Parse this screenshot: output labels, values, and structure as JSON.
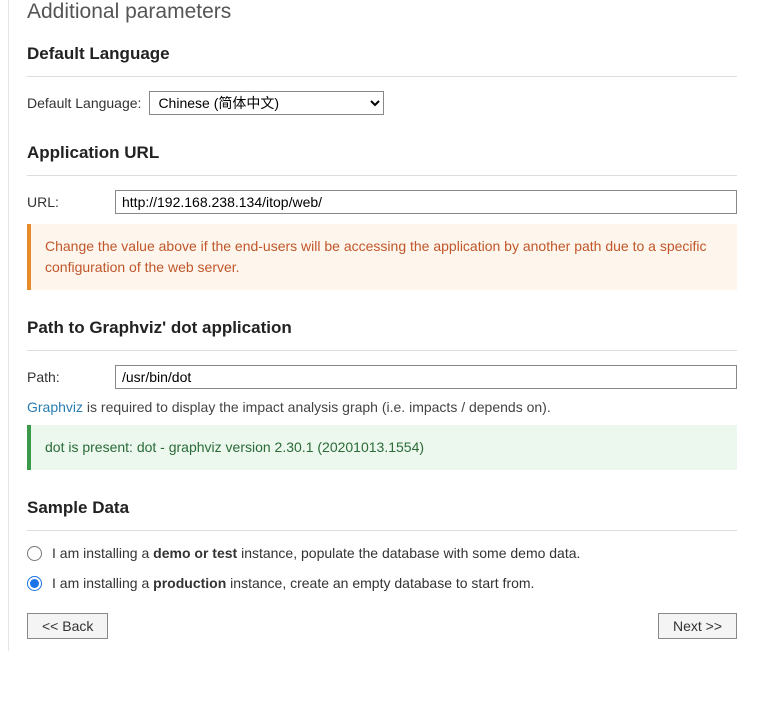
{
  "page_title": "Additional parameters",
  "sections": {
    "default_language": {
      "heading": "Default Language",
      "label": "Default Language:",
      "selected": "Chinese (简体中文)"
    },
    "app_url": {
      "heading": "Application URL",
      "label": "URL:",
      "value": "http://192.168.238.134/itop/web/",
      "warning": "Change the value above if the end-users will be accessing the application by another path due to a specific configuration of the web server."
    },
    "graphviz": {
      "heading": "Path to Graphviz' dot application",
      "label": "Path:",
      "value": "/usr/bin/dot",
      "link_text": "Graphviz",
      "help_rest": " is required to display the impact analysis graph (i.e. impacts / depends on).",
      "success": "dot is present: dot - graphviz version 2.30.1 (20201013.1554)"
    },
    "sample_data": {
      "heading": "Sample Data",
      "options": [
        {
          "pre": "I am installing a ",
          "strong": "demo or test",
          "post": " instance, populate the database with some demo data.",
          "checked": false
        },
        {
          "pre": "I am installing a ",
          "strong": "production",
          "post": " instance, create an empty database to start from.",
          "checked": true
        }
      ]
    }
  },
  "buttons": {
    "back": "<< Back",
    "next": "Next >>"
  }
}
